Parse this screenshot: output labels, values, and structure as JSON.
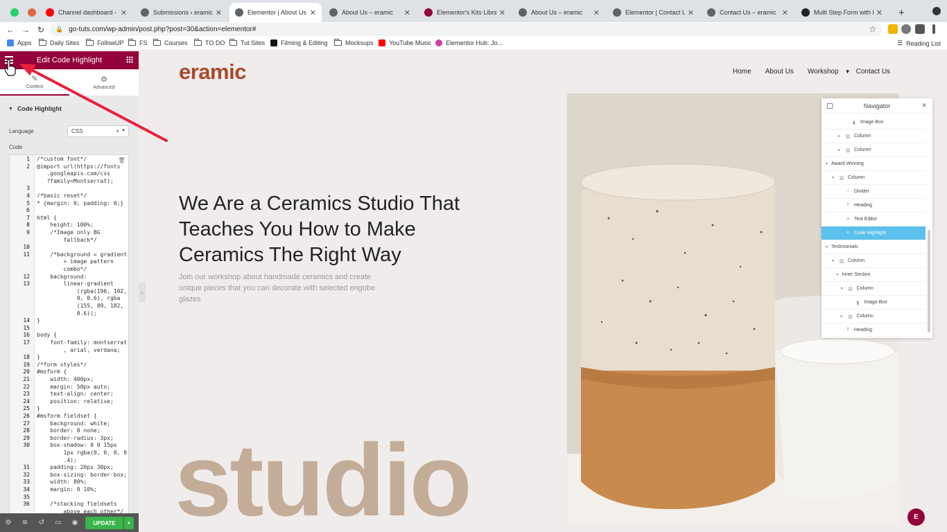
{
  "browser": {
    "tabs": [
      {
        "title": "",
        "icon": "whatsapp-icon",
        "color": "#25d366"
      },
      {
        "title": "",
        "icon": "app-icon",
        "color": "#e06c45"
      },
      {
        "title": "Channel dashboard - You",
        "icon": "youtube-icon",
        "color": "#ff0000"
      },
      {
        "title": "Submissions ‹ eramic —",
        "icon": "globe-icon",
        "color": "#5f6368"
      },
      {
        "title": "Elementor | About Us",
        "icon": "globe-icon",
        "color": "#5f6368",
        "active": true
      },
      {
        "title": "About Us – eramic",
        "icon": "globe-icon",
        "color": "#5f6368"
      },
      {
        "title": "Elementor's Kits Library",
        "icon": "elementor-icon",
        "color": "#93003a"
      },
      {
        "title": "About Us – eramic",
        "icon": "globe-icon",
        "color": "#5f6368"
      },
      {
        "title": "Elementor | Contact Us",
        "icon": "globe-icon",
        "color": "#5f6368"
      },
      {
        "title": "Contact Us – eramic",
        "icon": "globe-icon",
        "color": "#5f6368"
      },
      {
        "title": "Multi Step Form with Pro",
        "icon": "codepen-icon",
        "color": "#222222"
      }
    ],
    "new_tab": "+",
    "url": "go-tuts.com/wp-admin/post.php?post=30&action=elementor#",
    "bookmarks": [
      {
        "label": "Apps",
        "icon": "apps-icon"
      },
      {
        "label": "Daily Sites",
        "icon": "folder-icon"
      },
      {
        "label": "FollowUP",
        "icon": "folder-icon"
      },
      {
        "label": "FS",
        "icon": "folder-icon"
      },
      {
        "label": "Courses",
        "icon": "folder-icon"
      },
      {
        "label": "TO DO",
        "icon": "folder-icon"
      },
      {
        "label": "Tut Sites",
        "icon": "folder-icon"
      },
      {
        "label": "Filming & Editing",
        "icon": "k-icon"
      },
      {
        "label": "Mocksups",
        "icon": "folder-icon"
      },
      {
        "label": "YouTube Music",
        "icon": "youtube-icon"
      },
      {
        "label": "Elementor Hub: Jo...",
        "icon": "elementor-icon"
      }
    ],
    "reading_list": "Reading List"
  },
  "panel": {
    "title": "Edit Code Highlight",
    "tabs": [
      {
        "label": "Content"
      },
      {
        "label": "Advanced"
      }
    ],
    "section": "Code Highlight",
    "language_label": "Language",
    "language_value": "CSS",
    "code_label": "Code",
    "code_lines": [
      {
        "n": "1",
        "t": "/*custom font*/"
      },
      {
        "n": "2",
        "t": "@import url(https://fonts"
      },
      {
        "n": "",
        "t": "   .googleapis.com/css"
      },
      {
        "n": "",
        "t": "   ?family=Montserrat);"
      },
      {
        "n": "3",
        "t": ""
      },
      {
        "n": "4",
        "t": "/*basic reset*/"
      },
      {
        "n": "5",
        "t": "* {margin: 0; padding: 0;}"
      },
      {
        "n": "6",
        "t": ""
      },
      {
        "n": "7",
        "t": "html {"
      },
      {
        "n": "8",
        "t": "    height: 100%;"
      },
      {
        "n": "9",
        "t": "    /*Image only BG"
      },
      {
        "n": "",
        "t": "        fallback*/"
      },
      {
        "n": "10",
        "t": ""
      },
      {
        "n": "11",
        "t": "    /*background = gradient"
      },
      {
        "n": "",
        "t": "        + image pattern"
      },
      {
        "n": "",
        "t": "        combo*/"
      },
      {
        "n": "12",
        "t": "    background:"
      },
      {
        "n": "13",
        "t": "        linear-gradient"
      },
      {
        "n": "",
        "t": "            (rgba(196, 102,"
      },
      {
        "n": "",
        "t": "            0, 0.6), rgba"
      },
      {
        "n": "",
        "t": "            (155, 89, 182,"
      },
      {
        "n": "",
        "t": "            0.6));"
      },
      {
        "n": "14",
        "t": "}"
      },
      {
        "n": "15",
        "t": ""
      },
      {
        "n": "16",
        "t": "body {"
      },
      {
        "n": "17",
        "t": "    font-family: montserrat"
      },
      {
        "n": "",
        "t": "        , arial, verdana;"
      },
      {
        "n": "18",
        "t": "}"
      },
      {
        "n": "19",
        "t": "/*form styles*/"
      },
      {
        "n": "20",
        "t": "#msform {"
      },
      {
        "n": "21",
        "t": "    width: 400px;"
      },
      {
        "n": "22",
        "t": "    margin: 50px auto;"
      },
      {
        "n": "23",
        "t": "    text-align: center;"
      },
      {
        "n": "24",
        "t": "    position: relative;"
      },
      {
        "n": "25",
        "t": "}"
      },
      {
        "n": "26",
        "t": "#msform fieldset {"
      },
      {
        "n": "27",
        "t": "    background: white;"
      },
      {
        "n": "28",
        "t": "    border: 0 none;"
      },
      {
        "n": "29",
        "t": "    border-radius: 3px;"
      },
      {
        "n": "30",
        "t": "    box-shadow: 0 0 15px"
      },
      {
        "n": "",
        "t": "        1px rgba(0, 0, 0, 0"
      },
      {
        "n": "",
        "t": "        .4);"
      },
      {
        "n": "31",
        "t": "    padding: 20px 30px;"
      },
      {
        "n": "32",
        "t": "    box-sizing: border-box;"
      },
      {
        "n": "33",
        "t": "    width: 80%;"
      },
      {
        "n": "34",
        "t": "    margin: 0 10%;"
      },
      {
        "n": "35",
        "t": ""
      },
      {
        "n": "36",
        "t": "    /*stacking fieldsets"
      },
      {
        "n": "",
        "t": "        above each other*/"
      }
    ],
    "update_label": "UPDATE"
  },
  "site": {
    "logo": "eramic",
    "nav": [
      "Home",
      "About Us",
      "Workshop",
      "Contact Us"
    ],
    "headline": "We Are a Ceramics Studio That Teaches You How to Make Ceramics The Right Way",
    "subtext": "Join our workshop about handmade ceramics and create unique pieces that you can decorate with selected engobe glazes",
    "big_word": "studio"
  },
  "navigator": {
    "title": "Navigator",
    "items": [
      {
        "label": "Image Box",
        "depth": 3,
        "icon": "image-box-icon",
        "toggle": ""
      },
      {
        "label": "Column",
        "depth": 2,
        "icon": "column-icon",
        "toggle": "▸"
      },
      {
        "label": "Column",
        "depth": 2,
        "icon": "column-icon",
        "toggle": "▸"
      },
      {
        "label": "Award Winning",
        "depth": 0,
        "icon": "",
        "toggle": "▾"
      },
      {
        "label": "Column",
        "depth": 1,
        "icon": "column-icon",
        "toggle": "▾"
      },
      {
        "label": "Divider",
        "depth": 2,
        "icon": "divider-icon",
        "toggle": ""
      },
      {
        "label": "Heading",
        "depth": 2,
        "icon": "heading-icon",
        "toggle": ""
      },
      {
        "label": "Text Editor",
        "depth": 2,
        "icon": "text-editor-icon",
        "toggle": ""
      },
      {
        "label": "Code Highlight",
        "depth": 2,
        "icon": "code-icon",
        "toggle": "",
        "selected": true
      },
      {
        "label": "Testimonials",
        "depth": 0,
        "icon": "",
        "toggle": "▾"
      },
      {
        "label": "Column",
        "depth": 1,
        "icon": "column-icon",
        "toggle": "▾"
      },
      {
        "label": "Inner Section",
        "depth": 1.7,
        "icon": "",
        "toggle": "▾"
      },
      {
        "label": "Column",
        "depth": 2.4,
        "icon": "column-icon",
        "toggle": "▾"
      },
      {
        "label": "Image Box",
        "depth": 3.6,
        "icon": "image-box-icon",
        "toggle": ""
      },
      {
        "label": "Column",
        "depth": 2.4,
        "icon": "column-icon",
        "toggle": "▸"
      },
      {
        "label": "Heading",
        "depth": 2,
        "icon": "heading-icon",
        "toggle": ""
      }
    ]
  },
  "colors": {
    "elementor_brand": "#93003a",
    "update_green": "#39b54a",
    "logo": "#a9492d",
    "studio_text": "#c3ad98",
    "arrow": "#e8213a",
    "selected_row": "#5bc0eb"
  }
}
